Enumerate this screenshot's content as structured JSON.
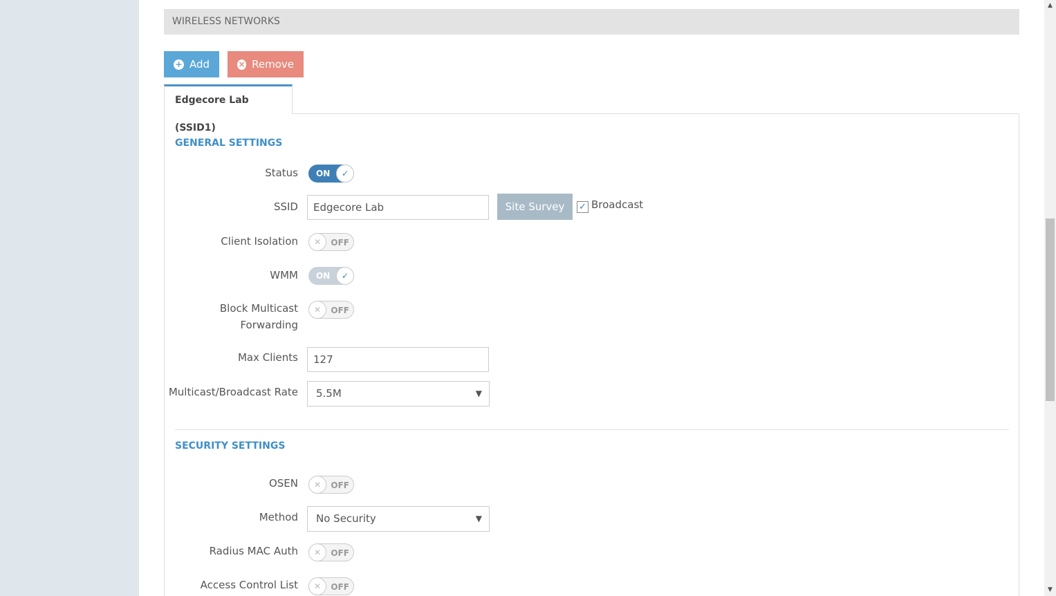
{
  "section": {
    "title": "WIRELESS NETWORKS"
  },
  "toolbar": {
    "add_label": "Add",
    "remove_label": "Remove"
  },
  "tabs": [
    {
      "label": "Edgecore Lab (SSID1)"
    }
  ],
  "general": {
    "title": "GENERAL SETTINGS",
    "status": {
      "label": "Status",
      "state": "ON"
    },
    "ssid": {
      "label": "SSID",
      "value": "Edgecore Lab",
      "site_survey_label": "Site Survey",
      "broadcast_label": "Broadcast",
      "broadcast_checked": true
    },
    "client_isolation": {
      "label": "Client Isolation",
      "state": "OFF"
    },
    "wmm": {
      "label": "WMM",
      "state": "ON"
    },
    "block_multicast": {
      "label_line1": "Block Multicast",
      "label_line2": "Forwarding",
      "state": "OFF"
    },
    "max_clients": {
      "label": "Max Clients",
      "value": "127"
    },
    "multicast_rate": {
      "label": "Multicast/Broadcast Rate",
      "value": "5.5M"
    }
  },
  "security": {
    "title": "SECURITY SETTINGS",
    "osen": {
      "label": "OSEN",
      "state": "OFF"
    },
    "method": {
      "label": "Method",
      "value": "No Security"
    },
    "radius_mac_auth": {
      "label": "Radius MAC Auth",
      "state": "OFF"
    },
    "access_control_list": {
      "label": "Access Control List",
      "state": "OFF"
    }
  },
  "icons": {
    "add": "plus-circle-icon",
    "remove": "x-circle-icon",
    "check": "check-icon",
    "x": "x-icon",
    "chevron": "chevron-down-icon"
  },
  "colors": {
    "accent": "#3e7fb5",
    "add_button": "#5aa7d8",
    "remove_button": "#e88a7e",
    "section_title": "#3f8fc8"
  }
}
